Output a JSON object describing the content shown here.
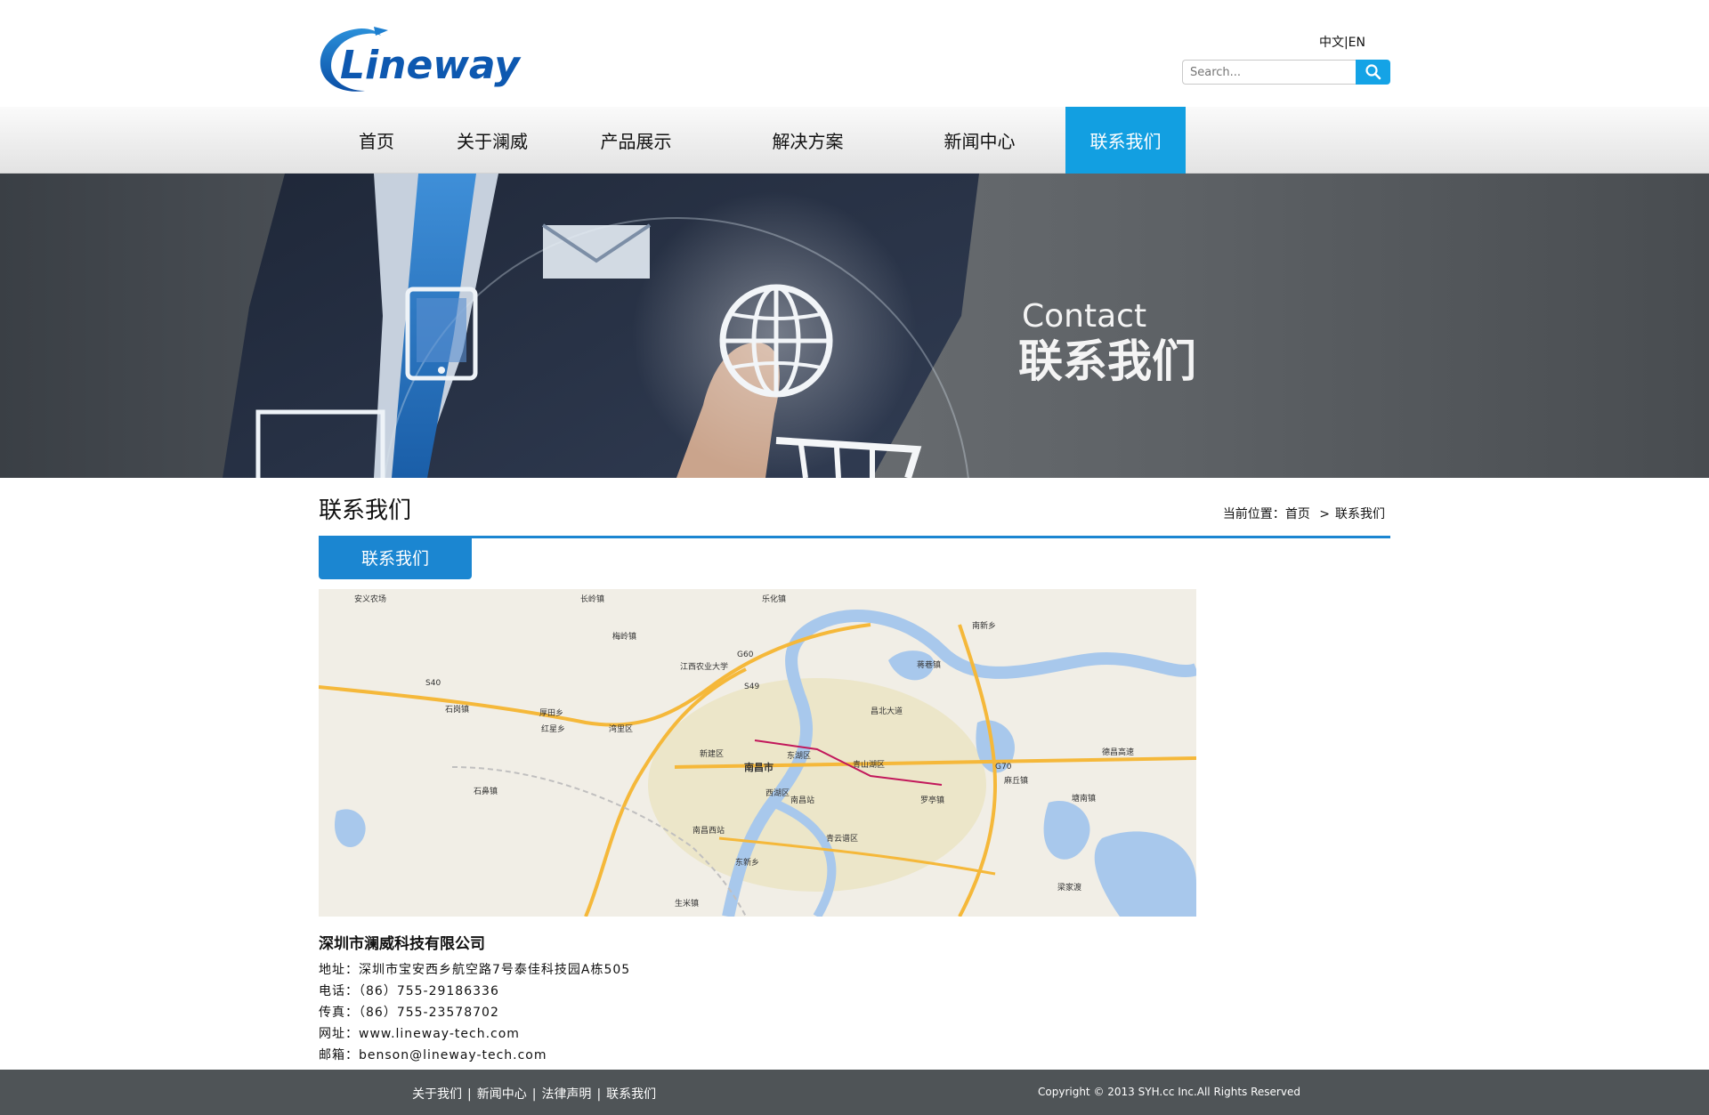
{
  "header": {
    "logo_text": "Lineway",
    "lang_cn": "中文",
    "lang_sep": "|",
    "lang_en": "EN",
    "search_placeholder": "Search..."
  },
  "nav": {
    "items": [
      {
        "label": "首页"
      },
      {
        "label": "关于澜威"
      },
      {
        "label": "产品展示"
      },
      {
        "label": "解决方案"
      },
      {
        "label": "新闻中心"
      },
      {
        "label": "联系我们"
      }
    ],
    "active_index": 5
  },
  "banner": {
    "title_en": "Contact",
    "title_cn": "联系我们"
  },
  "content": {
    "page_title": "联系我们",
    "breadcrumb_prefix": "当前位置：",
    "breadcrumb_home": "首页",
    "breadcrumb_sep": ">",
    "breadcrumb_current": "联系我们",
    "tab_label": "联系我们"
  },
  "map": {
    "labels": [
      "南昌市",
      "东湖区",
      "西湖区",
      "青山湖区",
      "青云谱区",
      "新建区",
      "湾里区",
      "昌北大道",
      "德昌高速",
      "G70",
      "G60",
      "S49",
      "S40",
      "乐化镇",
      "长岭镇",
      "南新乡",
      "蒋巷镇",
      "梅岭镇",
      "石岗镇",
      "厚田乡",
      "罗亭镇",
      "江西农业大学",
      "南昌西站",
      "南昌站",
      "东新乡",
      "塘南镇",
      "麻丘镇",
      "梁家渡",
      "安义农场",
      "红星乡",
      "石鼻镇",
      "生米镇"
    ]
  },
  "company": {
    "name": "深圳市澜威科技有限公司",
    "address": "地址：深圳市宝安西乡航空路7号泰佳科技园A栋505",
    "phone": "电话：（86）755-29186336",
    "fax": "传真：（86）755-23578702",
    "website": "网址：www.lineway-tech.com",
    "email": "邮箱：benson@lineway-tech.com"
  },
  "footer": {
    "links": [
      "关于我们",
      "新闻中心",
      "法律声明",
      "联系我们"
    ],
    "separator": "|",
    "copyright": "Copyright © 2013 SYH.cc Inc.All Rights Reserved"
  },
  "colors": {
    "accent": "#129fe1",
    "content_blue": "#1b86d1",
    "footer_bg": "#4f5457"
  }
}
